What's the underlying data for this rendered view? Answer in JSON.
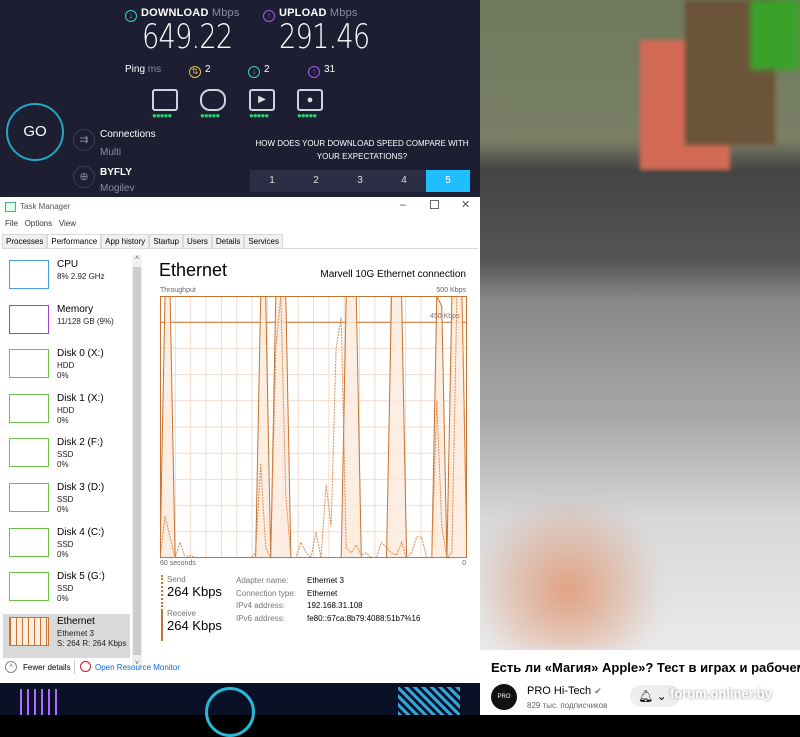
{
  "speedtest": {
    "download_label": "DOWNLOAD",
    "upload_label": "UPLOAD",
    "unit": "Mbps",
    "download": "649.22",
    "upload": "291.46",
    "ping_label": "Ping",
    "ping_unit": "ms",
    "ping_idle": "2",
    "ping_down": "2",
    "ping_up": "31",
    "go": "GO",
    "connections_label": "Connections",
    "connections_value": "Multi",
    "isp": "BYFLY",
    "location": "Mogilev",
    "question": "HOW DOES YOUR DOWNLOAD SPEED COMPARE WITH YOUR EXPECTATIONS?",
    "ratings": [
      "1",
      "2",
      "3",
      "4",
      "5"
    ],
    "selected_rating": "5",
    "activities": [
      "web-browsing-icon",
      "gaming-icon",
      "video-streaming-icon",
      "video-call-icon"
    ],
    "dots": "●●●●●",
    "colors": {
      "bg": "#1d1e31",
      "download": "#3ad0c9",
      "upload": "#a35cf0",
      "ping": "#e2c34d",
      "selected": "#1fbfff"
    }
  },
  "taskmanager": {
    "title": "Task Manager",
    "menu": [
      "File",
      "Options",
      "View"
    ],
    "tabs": [
      "Processes",
      "Performance",
      "App history",
      "Startup",
      "Users",
      "Details",
      "Services"
    ],
    "active_tab": "Performance",
    "sidebar": [
      {
        "name": "CPU",
        "l1": "8%  2.92 GHz",
        "l2": ""
      },
      {
        "name": "Memory",
        "l1": "11/128 GB (9%)",
        "l2": ""
      },
      {
        "name": "Disk 0 (X:)",
        "l1": "HDD",
        "l2": "0%"
      },
      {
        "name": "Disk 1 (X:)",
        "l1": "HDD",
        "l2": "0%"
      },
      {
        "name": "Disk 2 (F:)",
        "l1": "SSD",
        "l2": "0%"
      },
      {
        "name": "Disk 3 (D:)",
        "l1": "SSD",
        "l2": "0%"
      },
      {
        "name": "Disk 4 (C:)",
        "l1": "SSD",
        "l2": "0%"
      },
      {
        "name": "Disk 5 (G:)",
        "l1": "SSD",
        "l2": "0%"
      },
      {
        "name": "Ethernet",
        "l1": "Ethernet 3",
        "l2": "S: 264  R: 264 Kbps"
      }
    ],
    "heading": "Ethernet",
    "adapter_desc": "Marvell 10G Ethernet connection",
    "graph": {
      "label": "Throughput",
      "max_label": "500 Kbps",
      "mid_label": "450 Kbps",
      "left_label": "60 seconds",
      "right_label": "0",
      "max": 500,
      "receive": [
        0,
        500,
        500,
        0,
        0,
        0,
        0,
        0,
        0,
        0,
        0,
        0,
        0,
        0,
        0,
        0,
        0,
        0,
        0,
        0,
        500,
        500,
        0,
        500,
        500,
        500,
        0,
        0,
        0,
        0,
        0,
        0,
        0,
        0,
        0,
        0,
        0,
        500,
        500,
        500,
        0,
        0,
        0,
        0,
        0,
        0,
        500,
        500,
        500,
        0,
        0,
        0,
        0,
        0,
        0,
        500,
        480,
        0,
        500,
        500,
        500,
        0
      ],
      "send": [
        0,
        80,
        40,
        0,
        30,
        0,
        5,
        0,
        0,
        0,
        0,
        0,
        0,
        0,
        0,
        0,
        0,
        0,
        0,
        10,
        180,
        20,
        0,
        400,
        500,
        120,
        0,
        0,
        30,
        10,
        0,
        50,
        0,
        140,
        60,
        400,
        460,
        20,
        10,
        25,
        5,
        10,
        0,
        0,
        30,
        20,
        10,
        5,
        30,
        0,
        10,
        40,
        40,
        0,
        0,
        300,
        60,
        0,
        10,
        500,
        500,
        0
      ]
    },
    "send_label": "Send",
    "send_value": "264 Kbps",
    "receive_label": "Receive",
    "receive_value": "264 Kbps",
    "details": [
      {
        "k": "Adapter name:",
        "v": "Ethernet 3"
      },
      {
        "k": "Connection type:",
        "v": "Ethernet"
      },
      {
        "k": "IPv4 address:",
        "v": "192.168.31.108"
      },
      {
        "k": "IPv6 address:",
        "v": "fe80::67ca:8b79:4088:51b7%16"
      }
    ],
    "fewer_details": "Fewer details",
    "resource_monitor": "Open Resource Monitor"
  },
  "video": {
    "title": "Есть ли «Магия» Apple»? Тест в играх и рабочем",
    "channel": "PRO Hi-Tech",
    "subscribers": "829 тыс. подписчиков",
    "watermark": "forum.onliner.by",
    "logo": "PRO"
  }
}
